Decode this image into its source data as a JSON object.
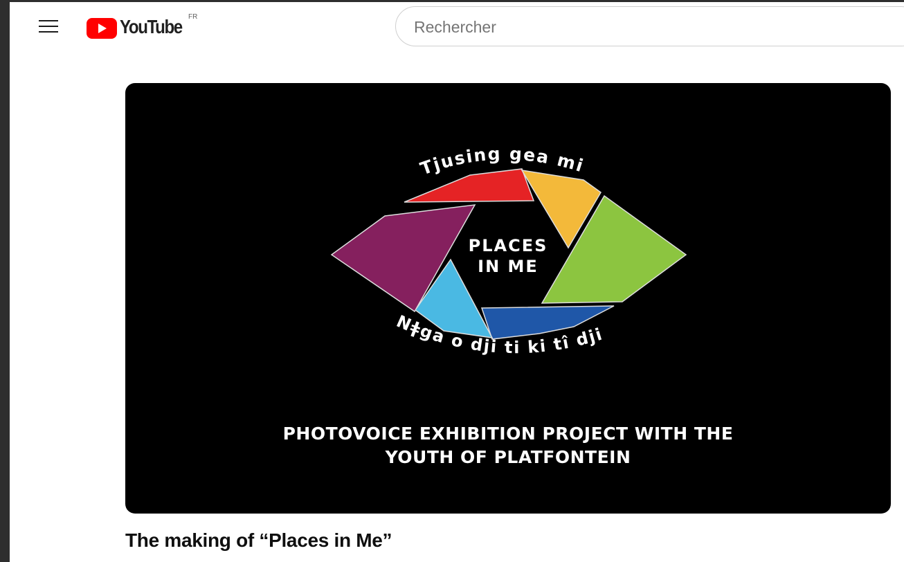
{
  "header": {
    "logo_text": "YouTube",
    "region_code": "FR",
    "search_placeholder": "Rechercher"
  },
  "video": {
    "logo_top_text": "Tjusing gea mi",
    "logo_center_line1": "PLACES",
    "logo_center_line2": "IN ME",
    "logo_bottom_text": "Nǂga o dji ti ki tî dji",
    "caption_line1": "PHOTOVOICE EXHIBITION PROJECT WITH THE",
    "caption_line2": "YOUTH OF PLATFONTEIN",
    "colors": {
      "red": "#e52325",
      "yellow": "#f3b93a",
      "green": "#8cc540",
      "blue": "#1f57a8",
      "light_blue": "#4ab9e3",
      "purple": "#85205e"
    }
  },
  "title": "The making of “Places in Me”",
  "colors": {
    "youtube_red": "#ff0000",
    "text_primary": "#0f0f0f"
  }
}
